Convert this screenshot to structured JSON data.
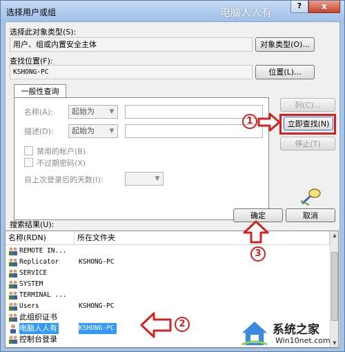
{
  "window": {
    "title": "选择用户或组",
    "watermark": "电脑人人有",
    "help_glyph": "?",
    "close_glyph": "x"
  },
  "object_type": {
    "label": "选择此对象类型(S):",
    "value": "用户、组或内置安全主体",
    "button": "对象类型(O)..."
  },
  "location": {
    "label": "查找位置(F):",
    "value": "KSHONG-PC",
    "button": "位置(L)..."
  },
  "query_tab": {
    "tab_label": "一般性查询",
    "name_label": "名称(A):",
    "name_mode": "起始为",
    "desc_label": "描述(D):",
    "desc_mode": "起始为",
    "disabled_accounts": "禁用的帐户(B)",
    "non_expiring_password": "不过期密码(X)",
    "days_since_logon": "自上次登录后的天数(I):"
  },
  "side_buttons": {
    "columns": "列(C)...",
    "find_now": "立即查找(N)",
    "stop": "停止(T)"
  },
  "ok_button": "确定",
  "cancel_button": "取消",
  "results": {
    "label": "搜索结果(U):",
    "columns": [
      "名称(RDN)",
      "所在文件夹"
    ],
    "rows": [
      {
        "name": "REMOTE IN...",
        "folder": ""
      },
      {
        "name": "Replicator",
        "folder": "KSHONG-PC"
      },
      {
        "name": "SERVICE",
        "folder": ""
      },
      {
        "name": "SYSTEM",
        "folder": ""
      },
      {
        "name": "TERMINAL ...",
        "folder": ""
      },
      {
        "name": "Users",
        "folder": "KSHONG-PC"
      },
      {
        "name": "此组织证书",
        "folder": ""
      },
      {
        "name": "电脑人人有",
        "folder": "KSHONG-PC",
        "selected": true
      },
      {
        "name": "控制台登录",
        "folder": ""
      }
    ]
  },
  "annotations": {
    "step1": "1",
    "step2": "2",
    "step3": "3",
    "color": "#d42020"
  },
  "branding": {
    "name": "系统之家",
    "url": "Win10net.com"
  },
  "colors": {
    "titlebar": "#a7c3e6",
    "selection": "#3399ff",
    "annotation": "#d42020"
  }
}
